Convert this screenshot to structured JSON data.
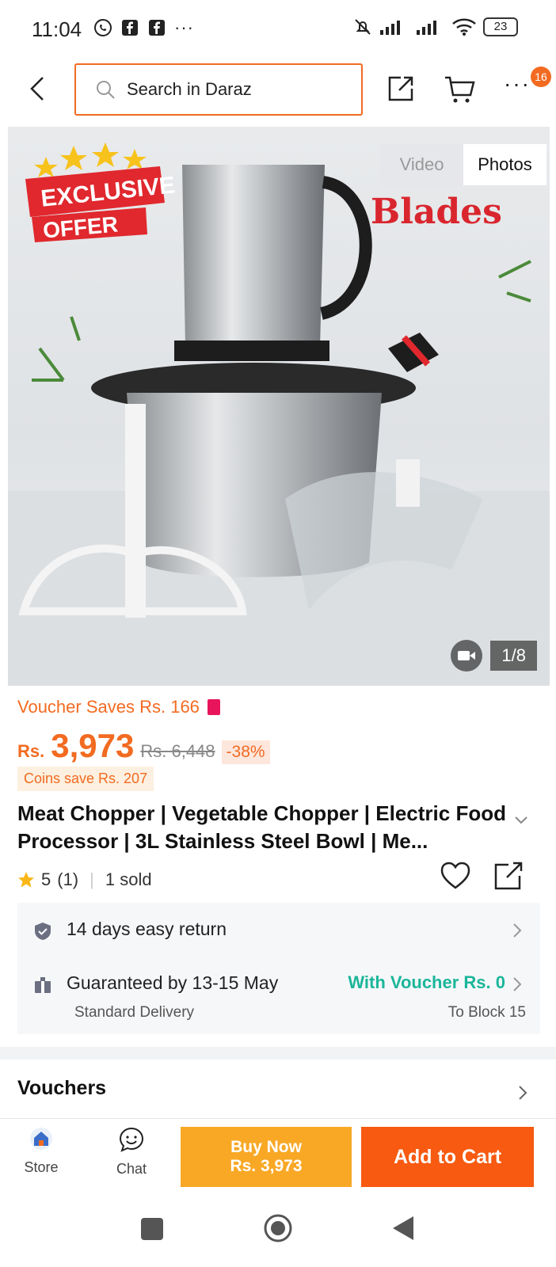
{
  "status_bar": {
    "time": "11:04",
    "battery": "23",
    "dots": "···"
  },
  "header": {
    "search_placeholder": "Search in Daraz",
    "badge_count": "16",
    "more": "···"
  },
  "gallery": {
    "tab_video": "Video",
    "tab_photos": "Photos",
    "counter": "1/8",
    "promo_line1": "EXCLUSIVE",
    "promo_line2": "OFFER",
    "image_headline": "Blades"
  },
  "product": {
    "voucher_saves": "Voucher Saves Rs. 166",
    "currency": "Rs.",
    "price": "3,973",
    "original_price": "Rs. 6,448",
    "discount": "-38%",
    "coins_save": "Coins save Rs. 207",
    "title": "Meat Chopper | Vegetable Chopper | Electric Food Processor | 3L Stainless Steel Bowl | Me...",
    "rating": "5",
    "rating_count": "(1)",
    "sold": "1 sold"
  },
  "service": {
    "return_text": "14 days easy return",
    "delivery_text": "Guaranteed by 13-15 May",
    "voucher_text": "With Voucher Rs. 0",
    "delivery_type": "Standard Delivery",
    "destination": "To Block 15"
  },
  "vouchers": {
    "title": "Vouchers"
  },
  "actions": {
    "store_label": "Store",
    "chat_label": "Chat",
    "buy_now_line1": "Buy Now",
    "buy_now_line2": "Rs. 3,973",
    "add_to_cart": "Add to Cart"
  },
  "colors": {
    "accent": "#f26b21",
    "buy_now": "#f9a826",
    "add_to_cart": "#f75a10",
    "voucher_green": "#1bb69a"
  }
}
